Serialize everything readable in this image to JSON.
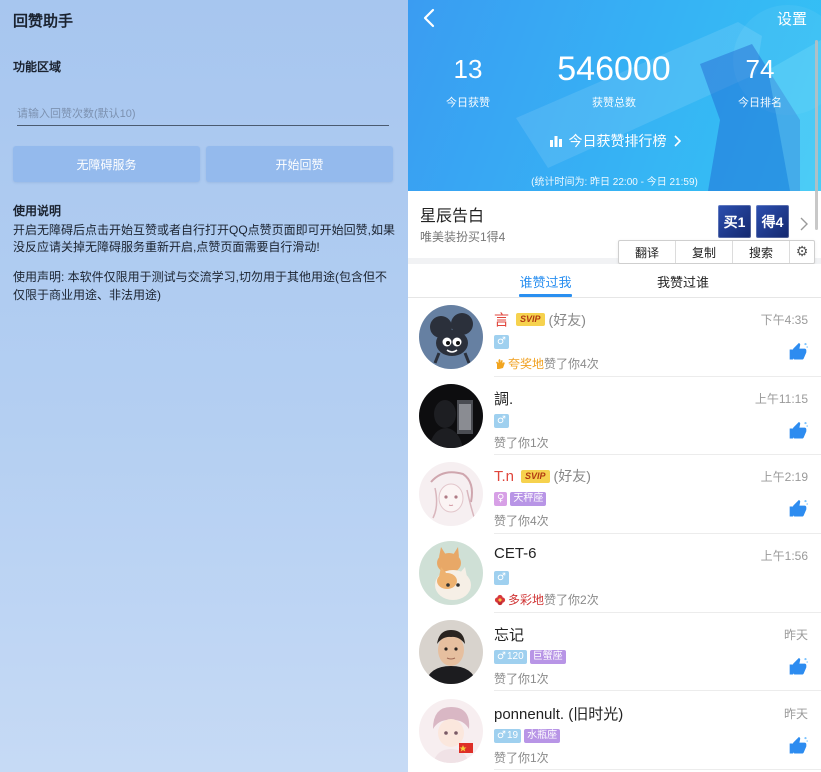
{
  "left": {
    "title": "回赞助手",
    "section_title": "功能区域",
    "input_placeholder": "请输入回赞次数(默认10)",
    "buttons": [
      "无障碍服务",
      "开始回赞"
    ],
    "instructions_title": "使用说明",
    "instructions_text": "开启无障碍后点击开始互赞或者自行打开QQ点赞页面即可开始回赞,如果没反应请关掉无障碍服务重新开启,点赞页面需要自行滑动!",
    "disclaimer_text": "使用声明: 本软件仅限用于测试与交流学习,切勿用于其他用途(包含但不仅限于商业用途、非法用途)"
  },
  "header": {
    "back_icon": "chevron-left-icon",
    "settings_label": "设置",
    "stats": [
      {
        "value": "13",
        "label": "今日获赞"
      },
      {
        "value": "546000",
        "label": "获赞总数"
      },
      {
        "value": "74",
        "label": "今日排名"
      }
    ],
    "ranking_icon": "bar-chart-icon",
    "ranking_label": "今日获赞排行榜",
    "stat_note": "(统计时间为: 昨日 22:00 - 今日 21:59)"
  },
  "promo": {
    "title": "星辰告白",
    "subtitle": "唯美装扮买1得4",
    "tiles": [
      "买1",
      "得4"
    ]
  },
  "context_menu": {
    "items": [
      "翻译",
      "复制",
      "搜索"
    ],
    "settings_icon": "gear-icon"
  },
  "tabs": [
    {
      "label": "谁赞过我",
      "active": true
    },
    {
      "label": "我赞过谁",
      "active": false
    }
  ],
  "likes": [
    {
      "avatar": "mouse-cartoon-avatar",
      "name": "言",
      "name_color": "#e0463c",
      "svip": true,
      "svip_label": "SVIP",
      "friend_label": "(好友)",
      "time": "下午4:35",
      "badges": [
        {
          "kind": "male",
          "icon": "male-icon"
        }
      ],
      "action_prefix_icon": "gold-hand-icon",
      "action_prefix": "夸奖地",
      "action_prefix_color": "#f0a020",
      "action": "赞了你4次",
      "thumbs_up": true
    },
    {
      "avatar": "silhouette-avatar",
      "name": "調.",
      "time": "上午11:15",
      "badges": [
        {
          "kind": "male",
          "icon": "male-icon"
        }
      ],
      "action": "赞了你1次",
      "thumbs_up": true
    },
    {
      "avatar": "sketch-girl-avatar",
      "name": "T.n",
      "name_color": "#e0463c",
      "svip": true,
      "svip_label": "SVIP",
      "friend_label": "(好友)",
      "time": "上午2:19",
      "badges": [
        {
          "kind": "female",
          "icon": "female-icon"
        },
        {
          "kind": "constellation",
          "text": "天秤座"
        }
      ],
      "action": "赞了你4次",
      "thumbs_up": true
    },
    {
      "avatar": "cat-avatar",
      "name": "CET-6",
      "time": "上午1:56",
      "badges": [
        {
          "kind": "male",
          "icon": "male-icon"
        }
      ],
      "action_prefix_icon": "red-flower-icon",
      "action_prefix": "多彩地",
      "action_prefix_color": "#d03434",
      "action": "赞了你2次",
      "thumbs_up": false
    },
    {
      "avatar": "man-avatar",
      "name": "忘记",
      "time": "昨天",
      "badges": [
        {
          "kind": "male",
          "icon": "male-icon",
          "text": "120"
        },
        {
          "kind": "constellation",
          "text": "巨蟹座"
        }
      ],
      "action": "赞了你1次",
      "thumbs_up": true
    },
    {
      "avatar": "anime-boy-avatar",
      "name": "ponnenult. (旧时光)",
      "time": "昨天",
      "badges": [
        {
          "kind": "male",
          "icon": "male-icon",
          "text": "19"
        },
        {
          "kind": "constellation",
          "text": "水瓶座"
        }
      ],
      "action": "赞了你1次",
      "thumbs_up": true
    }
  ],
  "colors": {
    "accent": "#2a8ff0",
    "header_start": "#3a9cf2",
    "header_end": "#34c4f5",
    "name_highlight": "#e0463c",
    "left_button": "#94baed"
  }
}
